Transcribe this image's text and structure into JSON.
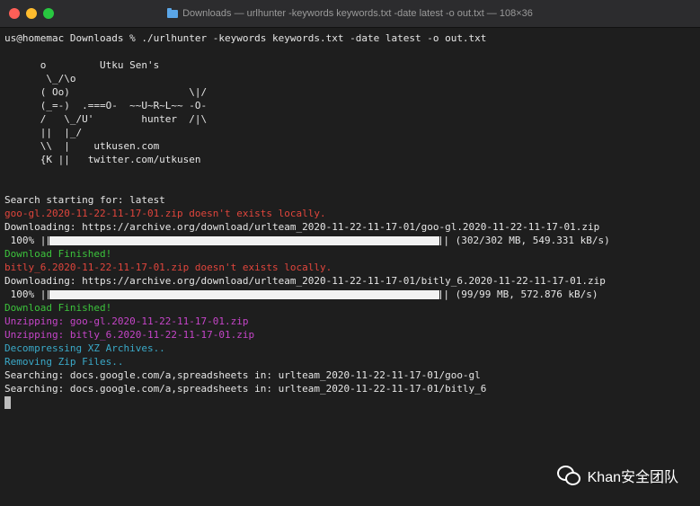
{
  "window": {
    "title": "Downloads — urlhunter -keywords keywords.txt -date latest -o out.txt — 108×36"
  },
  "terminal": {
    "prompt_line": "us@homemac Downloads % ./urlhunter -keywords keywords.txt -date latest -o out.txt",
    "ascii_art": "      o         Utku Sen's\n       \\_/\\o\n      ( Oo)                    \\|/\n      (_=-)  .===O-  ~~U~R~L~~ -O-\n      /   \\_/U'        hunter  /|\\\n      ||  |_/\n      \\\\  |    utkusen.com\n      {K ||   twitter.com/utkusen",
    "search_start": "Search starting for: latest",
    "file1_missing": "goo-gl.2020-11-22-11-17-01.zip doesn't exists locally.",
    "file1_downloading": "Downloading: https://archive.org/download/urlteam_2020-11-22-11-17-01/goo-gl.2020-11-22-11-17-01.zip",
    "progress1": {
      "percent_label": " 100% |",
      "stats": "| (302/302 MB, 549.331 kB/s)",
      "fraction": 1.0
    },
    "file1_finished": "Download Finished!",
    "file2_missing": "bitly_6.2020-11-22-11-17-01.zip doesn't exists locally.",
    "file2_downloading": "Downloading: https://archive.org/download/urlteam_2020-11-22-11-17-01/bitly_6.2020-11-22-11-17-01.zip",
    "progress2": {
      "percent_label": " 100% |",
      "stats": "| (99/99 MB, 572.876 kB/s)",
      "fraction": 1.0
    },
    "file2_finished": "Download Finished!",
    "unzip1": "Unzipping: goo-gl.2020-11-22-11-17-01.zip",
    "unzip2": "Unzipping: bitly_6.2020-11-22-11-17-01.zip",
    "decompress": "Decompressing XZ Archives..",
    "remove": "Removing Zip Files..",
    "search1": "Searching: docs.google.com/a,spreadsheets in: urlteam_2020-11-22-11-17-01/goo-gl",
    "search2": "Searching: docs.google.com/a,spreadsheets in: urlteam_2020-11-22-11-17-01/bitly_6"
  },
  "watermark": {
    "text": "Khan安全团队",
    "icon": "wechat-icon"
  },
  "colors": {
    "error": "#e0453c",
    "success": "#3cc33c",
    "unzip": "#c545c8",
    "info": "#3aa9c8"
  }
}
